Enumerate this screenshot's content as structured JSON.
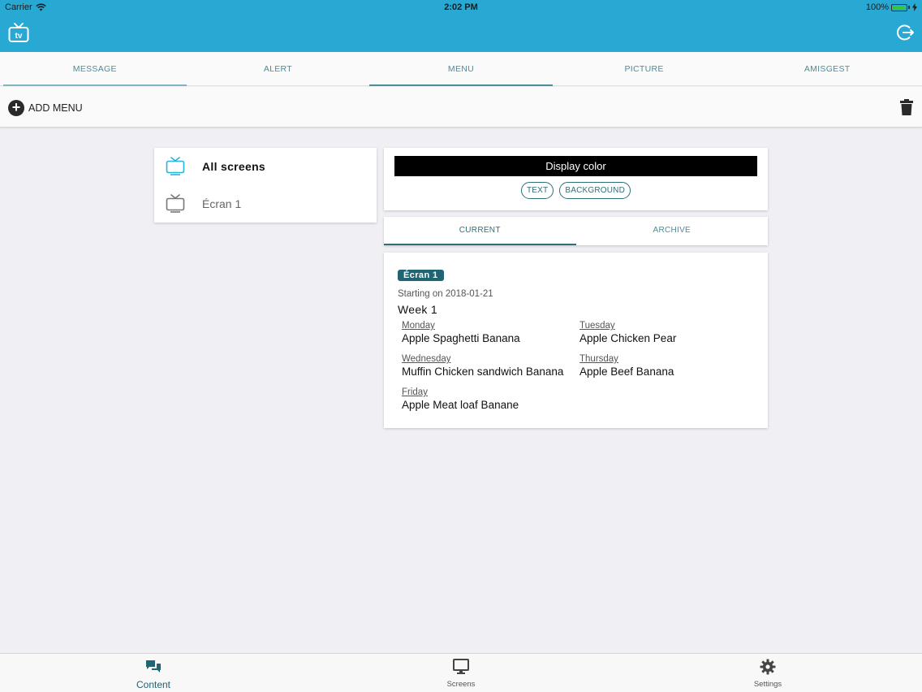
{
  "status_bar": {
    "carrier": "Carrier",
    "time": "2:02 PM",
    "battery": "100%"
  },
  "header": {
    "app_icon": "tv-app-icon",
    "logout_icon": "logout-icon",
    "brand_color": "#28a9d4"
  },
  "tabs": [
    {
      "label": "MESSAGE"
    },
    {
      "label": "ALERT"
    },
    {
      "label": "MENU"
    },
    {
      "label": "PICTURE"
    },
    {
      "label": "AMISGEST"
    }
  ],
  "toolbar": {
    "add_label": "ADD MENU",
    "delete_icon": "trash-icon"
  },
  "screens": [
    {
      "label": "All screens"
    },
    {
      "label": "Écran 1"
    }
  ],
  "display_color": {
    "title": "Display color",
    "text_button": "TEXT",
    "background_button": "BACKGROUND"
  },
  "subtabs": [
    {
      "label": "CURRENT"
    },
    {
      "label": "ARCHIVE"
    }
  ],
  "menu": {
    "badge": "Écran 1",
    "start": "Starting on 2018-01-21",
    "week": "Week 1",
    "days": [
      {
        "name": "Monday",
        "items": "Apple Spaghetti  Banana"
      },
      {
        "name": "Tuesday",
        "items": "Apple Chicken Pear"
      },
      {
        "name": "Wednesday",
        "items": "Muffin Chicken sandwich Banana"
      },
      {
        "name": "Thursday",
        "items": "Apple Beef Banana"
      },
      {
        "name": "Friday",
        "items": "Apple Meat loaf Banane"
      }
    ]
  },
  "bottom_nav": [
    {
      "label": "Content",
      "icon": "chat-icon"
    },
    {
      "label": "Screens",
      "icon": "monitor-icon"
    },
    {
      "label": "Settings",
      "icon": "gear-icon"
    }
  ]
}
